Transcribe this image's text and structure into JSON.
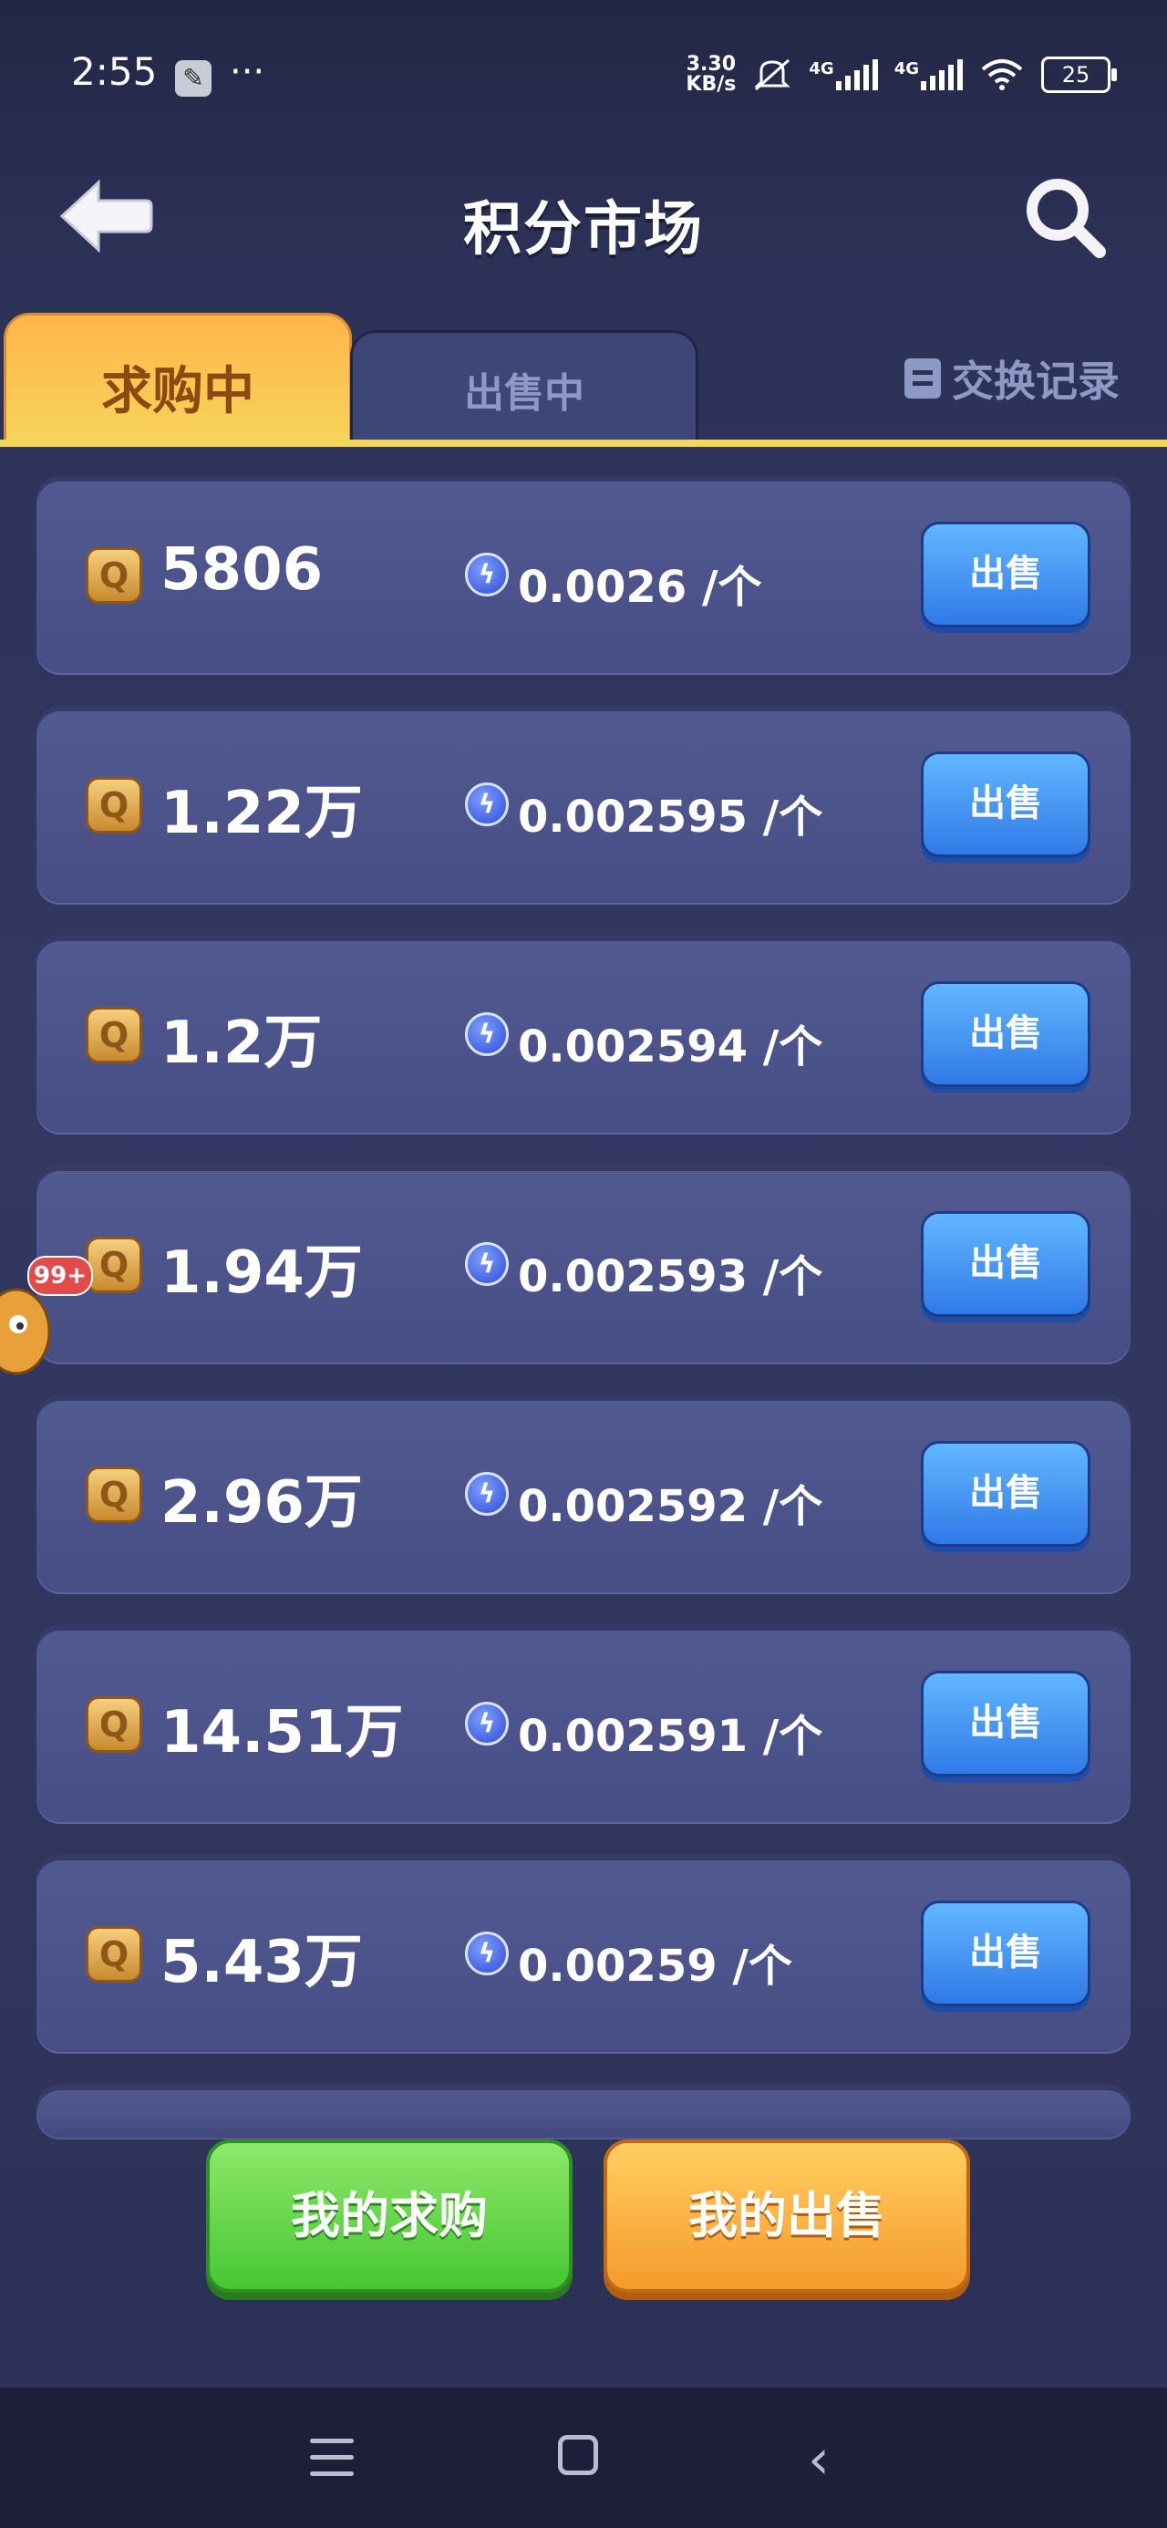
{
  "status_bar": {
    "time": "2:55",
    "speed": "3.30",
    "speed_unit": "KB/s",
    "network1": "4G",
    "network2": "4G",
    "battery": "25",
    "more": "···"
  },
  "header": {
    "title": "积分市场"
  },
  "tabs": {
    "buying": "求购中",
    "selling": "出售中",
    "history": "交换记录"
  },
  "orders": [
    {
      "amount": "5806",
      "price": "0.0026",
      "unit": "/个",
      "action": "出售"
    },
    {
      "amount": "1.22万",
      "price": "0.002595",
      "unit": "/个",
      "action": "出售"
    },
    {
      "amount": "1.2万",
      "price": "0.002594",
      "unit": "/个",
      "action": "出售"
    },
    {
      "amount": "1.94万",
      "price": "0.002593",
      "unit": "/个",
      "action": "出售"
    },
    {
      "amount": "2.96万",
      "price": "0.002592",
      "unit": "/个",
      "action": "出售"
    },
    {
      "amount": "14.51万",
      "price": "0.002591",
      "unit": "/个",
      "action": "出售"
    },
    {
      "amount": "5.43万",
      "price": "0.00259",
      "unit": "/个",
      "action": "出售"
    }
  ],
  "floating": {
    "badge": "99+"
  },
  "bottom_buttons": {
    "my_buy": "我的求购",
    "my_sell": "我的出售"
  },
  "icons": {
    "back": "back-arrow-icon",
    "search": "search-icon",
    "coin": "coin-icon",
    "bolt": "energy-icon"
  },
  "colors": {
    "tab_active": "#ffb54a",
    "sell_button": "#2f7ae7",
    "buy_green": "#46c632",
    "sell_orange": "#f59a2c"
  }
}
